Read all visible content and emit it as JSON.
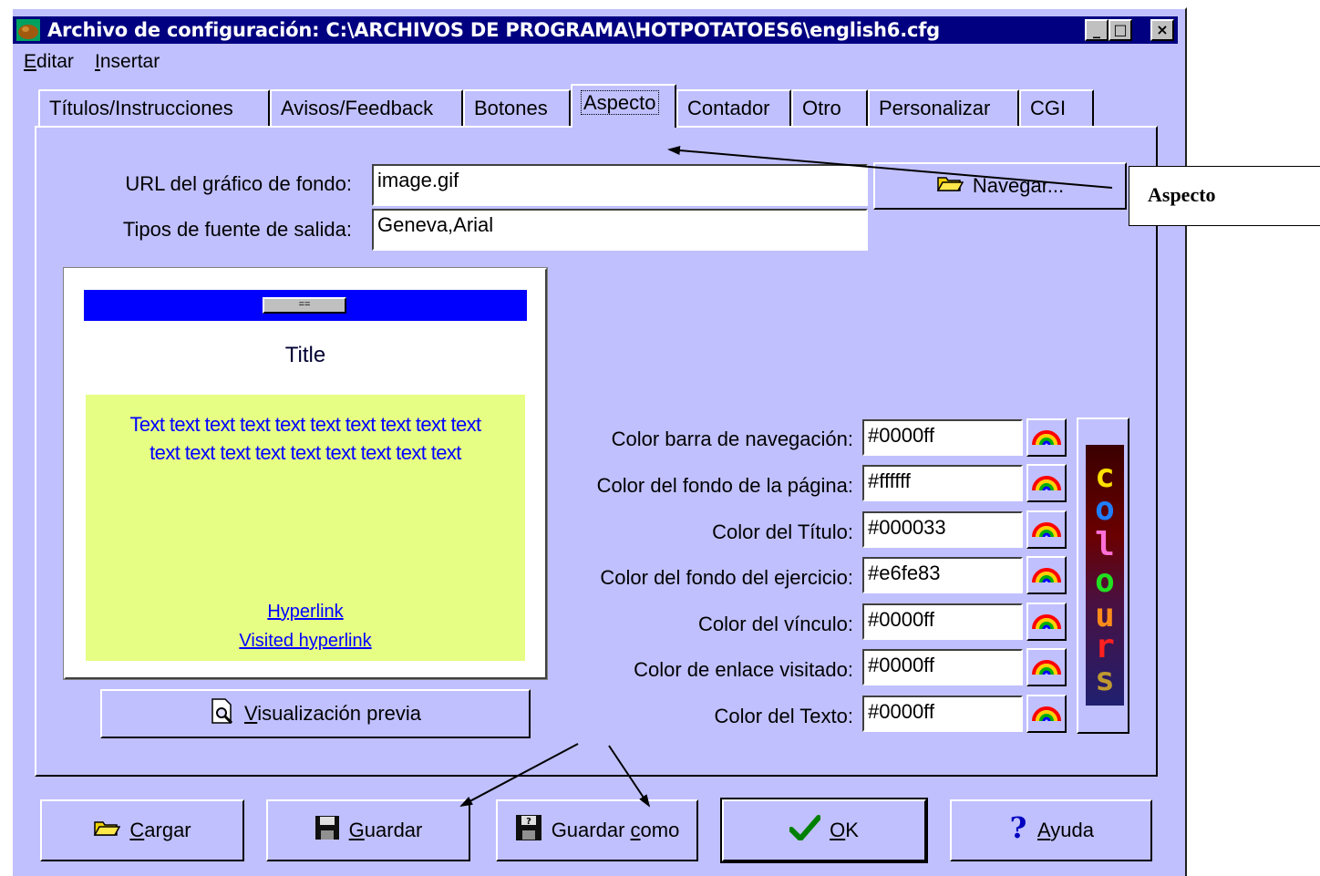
{
  "window": {
    "title": "Archivo de configuración: C:\\ARCHIVOS DE PROGRAMA\\HOTPOTATOES6\\english6.cfg",
    "controls": {
      "minimize": "_",
      "maximize": "□",
      "close": "×"
    }
  },
  "menu": {
    "items": [
      {
        "label": "Editar",
        "accel": "E",
        "rest": "ditar"
      },
      {
        "label": "Insertar",
        "accel": "I",
        "rest": "nsertar"
      }
    ]
  },
  "tabs": [
    {
      "label": "Títulos/Instrucciones",
      "active": false
    },
    {
      "label": "Avisos/Feedback",
      "active": false
    },
    {
      "label": "Botones",
      "active": false
    },
    {
      "label": "Aspecto",
      "active": true
    },
    {
      "label": "Contador",
      "active": false
    },
    {
      "label": "Otro",
      "active": false
    },
    {
      "label": "Personalizar",
      "active": false
    },
    {
      "label": "CGI",
      "active": false
    }
  ],
  "aspecto": {
    "bg_url_label": "URL del gráfico de fondo:",
    "bg_url_value": "image.gif",
    "browse_label": "Navegar...",
    "fonts_label": "Tipos de fuente de salida:",
    "fonts_value": "Geneva,Arial"
  },
  "preview": {
    "nav_button": "==",
    "title": "Title",
    "text_line1": "Text text text text text text text text text text",
    "text_line2": "text text text text text text text text text",
    "hyperlink": "Hyperlink",
    "visited_hyperlink": "Visited hyperlink",
    "preview_button_accel": "V",
    "preview_button_rest": "isualización previa"
  },
  "colors": [
    {
      "label": "Color barra de navegación:",
      "value": "#0000ff"
    },
    {
      "label": "Color del fondo de la página:",
      "value": "#ffffff"
    },
    {
      "label": "Color del Título:",
      "value": "#000033"
    },
    {
      "label": "Color del fondo del ejercicio:",
      "value": "#e6fe83"
    },
    {
      "label": "Color del vínculo:",
      "value": "#0000ff"
    },
    {
      "label": "Color de enlace visitado:",
      "value": "#0000ff"
    },
    {
      "label": "Color del Texto:",
      "value": "#0000ff"
    }
  ],
  "colours_logo": [
    "c",
    "o",
    "l",
    "o",
    "u",
    "r",
    "s"
  ],
  "buttons": {
    "cargar": {
      "accel": "C",
      "rest": "argar"
    },
    "guardar": {
      "accel": "G",
      "rest": "uardar"
    },
    "guardar_como": {
      "pre": "Guardar ",
      "accel": "c",
      "rest": "omo"
    },
    "ok": {
      "accel": "O",
      "rest": "K"
    },
    "ayuda": {
      "accel": "A",
      "rest": "yuda"
    }
  },
  "callout": {
    "label": "Aspecto"
  },
  "palette": {
    "window_bg": "#c0c0ff",
    "titlebar_bg": "#000080",
    "nav_bar": "#0000ff",
    "exercise_bg": "#e6fe83",
    "link": "#0000ff"
  }
}
